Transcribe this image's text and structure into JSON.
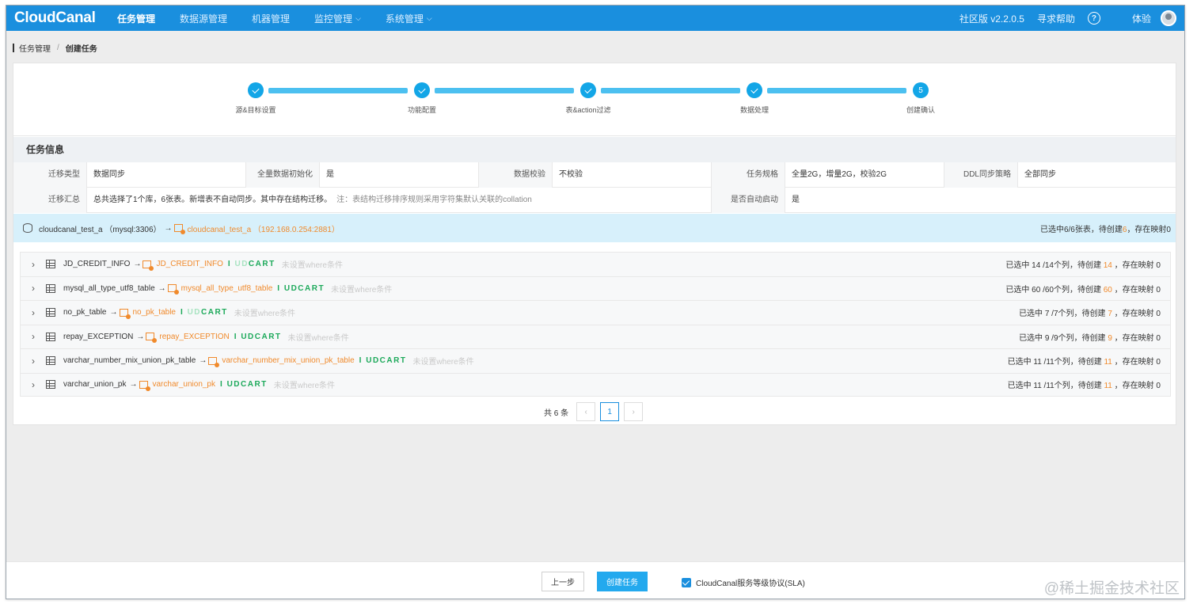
{
  "nav": {
    "logo": "CloudCanal",
    "items": [
      "任务管理",
      "数据源管理",
      "机器管理",
      "监控管理",
      "系统管理"
    ],
    "version": "社区版 v2.2.0.5",
    "help": "寻求帮助",
    "help_icon": "?",
    "user": "体验"
  },
  "breadcrumb": {
    "parent": "任务管理",
    "sep": "/",
    "current": "创建任务"
  },
  "steps": [
    {
      "label": "源&目标设置",
      "state": "done"
    },
    {
      "label": "功能配置",
      "state": "done"
    },
    {
      "label": "表&action过滤",
      "state": "done"
    },
    {
      "label": "数据处理",
      "state": "done"
    },
    {
      "label": "创建确认",
      "state": "current",
      "num": "5"
    }
  ],
  "info": {
    "title": "任务信息",
    "row1": [
      {
        "k": "迁移类型",
        "v": "数据同步"
      },
      {
        "k": "全量数据初始化",
        "v": "是"
      },
      {
        "k": "数据校验",
        "v": "不校验"
      },
      {
        "k": "任务规格",
        "v": "全量2G，增量2G，校验2G"
      },
      {
        "k": "DDL同步策略",
        "v": "全部同步"
      }
    ],
    "row2": {
      "k": "迁移汇总",
      "v": "总共选择了1个库，6张表。新增表不自动同步。其中存在结构迁移。",
      "note": "注：表结构迁移排序规则采用字符集默认关联的collation",
      "k2": "是否自动启动",
      "v2": "是"
    }
  },
  "db": {
    "src": "cloudcanal_test_a （mysql:3306）",
    "arrow": "→",
    "tgt": "cloudcanal_test_a （192.168.0.254:2881）",
    "summary_pre": "已选中6/6张表，待创建",
    "summary_num": "6",
    "summary_post": "，存在映射0"
  },
  "tables": [
    {
      "src": "JD_CREDIT_INFO",
      "tgt": "JD_CREDIT_INFO",
      "where": "未设置where条件",
      "pre": "已选中 14 /14个列，待创建 ",
      "num": "14",
      "post": " ，存在映射 0",
      "dim": "UD",
      "bright": "CART"
    },
    {
      "src": "mysql_all_type_utf8_table",
      "tgt": "mysql_all_type_utf8_table",
      "where": "未设置where条件",
      "pre": "已选中 60 /60个列，待创建 ",
      "num": "60",
      "post": " ，存在映射 0",
      "dim": "",
      "bright": "UDCART"
    },
    {
      "src": "no_pk_table",
      "tgt": "no_pk_table",
      "where": "未设置where条件",
      "pre": "已选中 7 /7个列，待创建 ",
      "num": "7",
      "post": " ，存在映射 0",
      "dim": "UD",
      "bright": "CART"
    },
    {
      "src": "repay_EXCEPTION",
      "tgt": "repay_EXCEPTION",
      "where": "未设置where条件",
      "pre": "已选中 9 /9个列，待创建 ",
      "num": "9",
      "post": " ，存在映射 0",
      "dim": "",
      "bright": "UDCART"
    },
    {
      "src": "varchar_number_mix_union_pk_table",
      "tgt": "varchar_number_mix_union_pk_table",
      "where": "未设置where条件",
      "pre": "已选中 11 /11个列，待创建 ",
      "num": "11",
      "post": " ，存在映射 0",
      "dim": "",
      "bright": "UDCART"
    },
    {
      "src": "varchar_union_pk",
      "tgt": "varchar_union_pk",
      "where": "未设置where条件",
      "pre": "已选中 11 /11个列，待创建 ",
      "num": "11",
      "post": " ，存在映射 0",
      "dim": "",
      "bright": "UDCART"
    }
  ],
  "pager": {
    "total": "共 6 条",
    "prev": "‹",
    "page": "1",
    "next": "›"
  },
  "footer": {
    "prev": "上一步",
    "create": "创建任务",
    "sla": "CloudCanal服务等级协议(SLA)",
    "watermark": "@稀土掘金技术社区"
  },
  "colors": {
    "nav": "#1a8fde",
    "accent": "#13a6e7",
    "orange": "#f08a2c",
    "green": "#1ca95a"
  }
}
